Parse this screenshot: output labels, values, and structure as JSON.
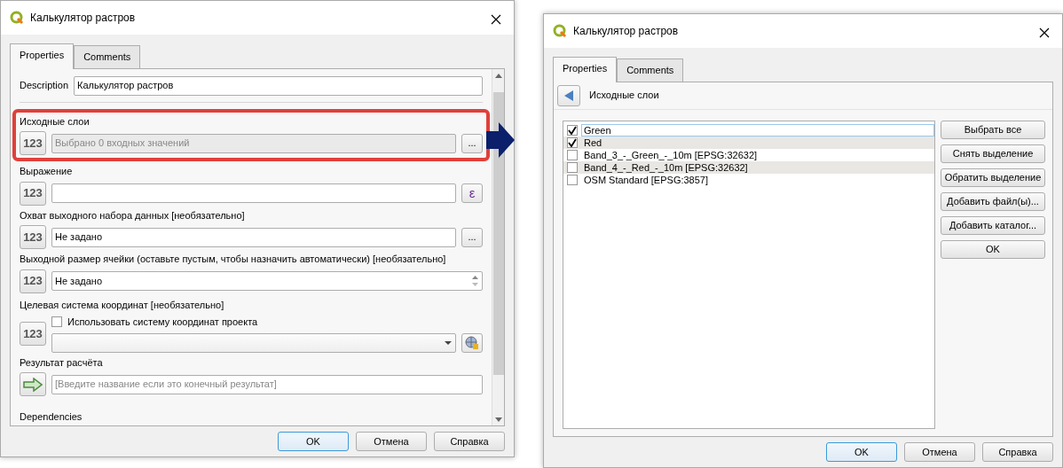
{
  "left_window": {
    "title": "Калькулятор растров",
    "tabs": [
      {
        "label": "Properties",
        "selected": true
      },
      {
        "label": "Comments",
        "selected": false
      }
    ],
    "description": {
      "label": "Description",
      "value": "Калькулятор растров"
    },
    "params": [
      {
        "kind": "multi",
        "label": "Исходные слои",
        "value": "Выбрано 0 входных значений",
        "disabled": true,
        "source_button": "123",
        "button": "...",
        "highlighted": true
      },
      {
        "kind": "expression",
        "label": "Выражение",
        "source_button": "123",
        "button": "ε",
        "highlighted": false
      },
      {
        "kind": "extent",
        "label": "Охват выходного набора данных [необязательно]",
        "value": "Не задано",
        "disabled": false,
        "source_button": "123",
        "button": "...",
        "highlighted": false
      },
      {
        "kind": "number",
        "label": "Выходной размер ячейки (оставьте пустым, чтобы назначить автоматически) [необязательно]",
        "value": "Не задано",
        "source_button": "123",
        "highlighted": false
      },
      {
        "kind": "crs",
        "label": "Целевая система координат [необязательно]",
        "source_button": "123",
        "checkbox": {
          "label": "Использовать систему координат проекта",
          "checked": false
        },
        "highlighted": false
      },
      {
        "kind": "output",
        "label": "Результат расчёта",
        "placeholder": "[Введите название если это конечный результат]",
        "highlighted": false
      },
      {
        "kind": "section",
        "label": "Dependencies",
        "highlighted": false
      }
    ],
    "buttons": [
      {
        "label": "OK",
        "default": true
      },
      {
        "label": "Отмена",
        "default": false
      },
      {
        "label": "Справка",
        "default": false
      }
    ]
  },
  "right_window": {
    "title": "Калькулятор растров",
    "tabs": [
      {
        "label": "Properties",
        "selected": true
      },
      {
        "label": "Comments",
        "selected": false
      }
    ],
    "header": "Исходные слои",
    "layers": [
      {
        "label": "Green",
        "checked": true,
        "selected": true
      },
      {
        "label": "Red",
        "checked": true,
        "selected": false
      },
      {
        "label": "Band_3_-_Green_-_10m [EPSG:32632]",
        "checked": false,
        "selected": false
      },
      {
        "label": "Band_4_-_Red_-_10m [EPSG:32632]",
        "checked": false,
        "selected": false
      },
      {
        "label": "OSM Standard [EPSG:3857]",
        "checked": false,
        "selected": false
      }
    ],
    "side_buttons": [
      "Выбрать все",
      "Снять выделение",
      "Обратить выделение",
      "Добавить файл(ы)...",
      "Добавить каталог...",
      "OK"
    ],
    "buttons": [
      {
        "label": "OK",
        "default": true
      },
      {
        "label": "Отмена",
        "default": false
      },
      {
        "label": "Справка",
        "default": false
      }
    ]
  }
}
